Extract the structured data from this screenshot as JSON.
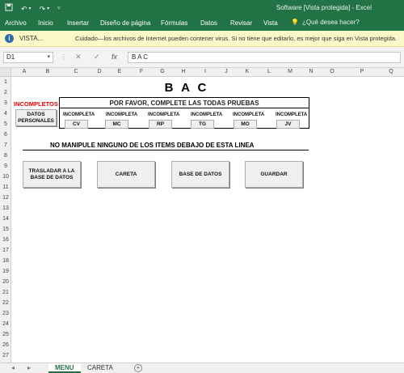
{
  "title_bar": {
    "window_title": "Software  [Vista protegida] - Excel",
    "qat_icons": [
      "save-icon",
      "undo-icon",
      "redo-icon"
    ]
  },
  "ribbon": {
    "tabs": [
      "Archivo",
      "Inicio",
      "Insertar",
      "Diseño de página",
      "Fórmulas",
      "Datos",
      "Revisar",
      "Vista"
    ],
    "tell_me": "¿Qué desea hacer?"
  },
  "protected_view": {
    "label": "VISTA...",
    "message": "Cuidado—los archivos de Internet pueden contener virus. Si no tiene que editarlo, es mejor que siga en Vista protegida."
  },
  "formula_bar": {
    "name_box": "D1",
    "fx_label": "fx",
    "cancel": "✕",
    "enter": "✓",
    "value": "B A C"
  },
  "columns": [
    "A",
    "B",
    "C",
    "D",
    "E",
    "F",
    "G",
    "H",
    "I",
    "J",
    "K",
    "L",
    "M",
    "N",
    "O",
    "P",
    "Q"
  ],
  "rows": [
    "1",
    "2",
    "3",
    "4",
    "5",
    "6",
    "7",
    "8",
    "9",
    "10",
    "11",
    "12",
    "13",
    "14",
    "15",
    "16",
    "17",
    "18",
    "19",
    "20",
    "21",
    "22",
    "23",
    "24",
    "25",
    "26",
    "27"
  ],
  "sheet": {
    "heading": "B A C",
    "incompletos": "INCOMPLETOS",
    "datos_personales": "DATOS PERSONALES",
    "instructions": "POR FAVOR, COMPLETE LAS TODAS PRUEBAS",
    "tests": [
      {
        "status": "INCOMPLETA",
        "code": "CV"
      },
      {
        "status": "INCOMPLETA",
        "code": "MC"
      },
      {
        "status": "INCOMPLETA",
        "code": "RP"
      },
      {
        "status": "INCOMPLETA",
        "code": "TG"
      },
      {
        "status": "INCOMPLETA",
        "code": "MO"
      },
      {
        "status": "INCOMPLETA",
        "code": "JV"
      }
    ],
    "warning": "NO MANIPULE NINGUNO DE LOS ITEMS DEBAJO DE ESTA LINEA",
    "actions": [
      "TRASLADAR A LA BASE DE DATOS",
      "CARETA",
      "BASE DE DATOS",
      "GUARDAR"
    ]
  },
  "sheet_tabs": {
    "tabs": [
      "MENU",
      "CARETA"
    ],
    "active": "MENU"
  },
  "colors": {
    "excel_green": "#217346",
    "protected_bar": "#fcf8c8",
    "incomplete_red": "#e00000"
  }
}
